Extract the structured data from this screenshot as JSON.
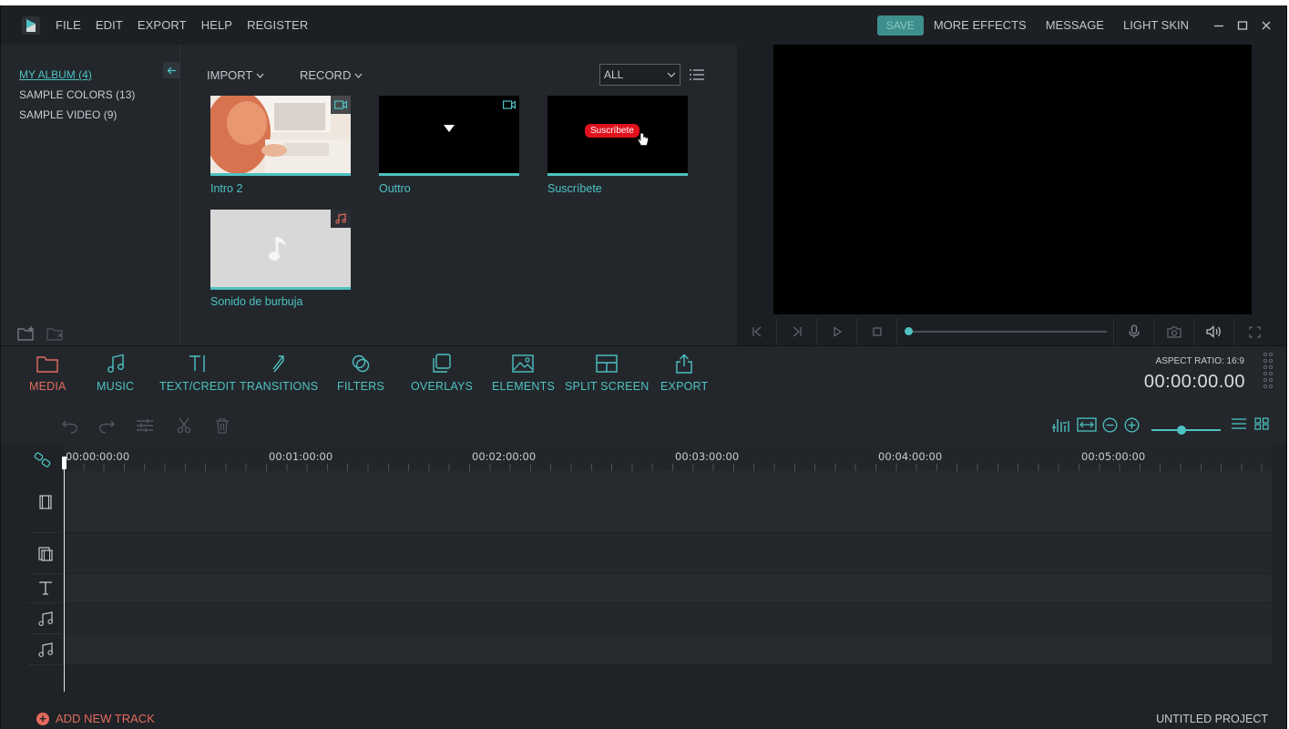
{
  "menu": [
    "FILE",
    "EDIT",
    "EXPORT",
    "HELP",
    "REGISTER"
  ],
  "topbar": {
    "save": "SAVE",
    "more_effects": "MORE EFFECTS",
    "message": "MESSAGE",
    "light_skin": "LIGHT SKIN"
  },
  "albums": [
    {
      "label": "MY ALBUM (4)",
      "active": true
    },
    {
      "label": "SAMPLE COLORS (13)",
      "active": false
    },
    {
      "label": "SAMPLE VIDEO (9)",
      "active": false
    }
  ],
  "media": {
    "import": "IMPORT",
    "record": "RECORD",
    "filter_value": "ALL",
    "items": [
      {
        "label": "Intro 2",
        "type": "video"
      },
      {
        "label": "Outtro",
        "type": "video"
      },
      {
        "label": "Suscríbete",
        "type": "video",
        "overlay_text": "Suscríbete"
      },
      {
        "label": "Sonido de burbuja",
        "type": "audio"
      }
    ]
  },
  "tools": [
    {
      "label": "MEDIA",
      "icon": "folder-icon",
      "active": true
    },
    {
      "label": "MUSIC",
      "icon": "music-icon"
    },
    {
      "label": "TEXT/CREDIT",
      "icon": "text-icon"
    },
    {
      "label": "TRANSITIONS",
      "icon": "transitions-icon"
    },
    {
      "label": "FILTERS",
      "icon": "filters-icon"
    },
    {
      "label": "OVERLAYS",
      "icon": "overlays-icon"
    },
    {
      "label": "ELEMENTS",
      "icon": "elements-icon"
    },
    {
      "label": "SPLIT SCREEN",
      "icon": "split-screen-icon"
    },
    {
      "label": "EXPORT",
      "icon": "export-icon"
    }
  ],
  "preview": {
    "aspect_ratio": "ASPECT RATIO: 16:9",
    "timecode": "00:00:00.00"
  },
  "timeline": {
    "ruler": [
      "00:00:00:00",
      "00:01:00:00",
      "00:02:00:00",
      "00:03:00:00",
      "00:04:00:00",
      "00:05:00:00"
    ],
    "add_track": "ADD NEW TRACK",
    "project_name": "UNTITLED PROJECT"
  },
  "colors": {
    "accent": "#4ec2c2",
    "active": "#e46a5e",
    "background": "#23272c"
  }
}
